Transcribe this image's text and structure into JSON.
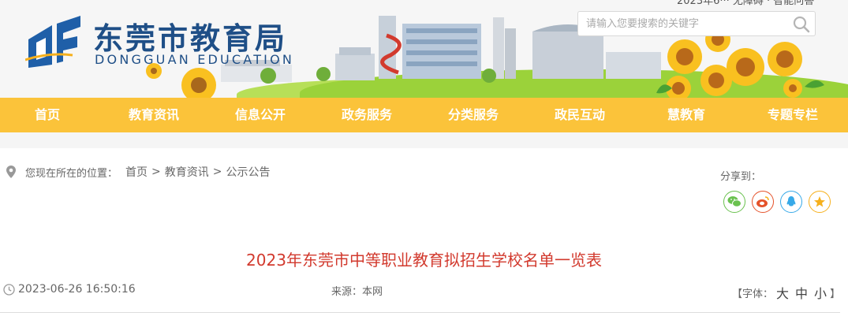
{
  "header": {
    "site_title": "东莞市教育局",
    "site_subtitle": "DONGGUAN EDUCATION",
    "top_info": "2023年6··· 无障碍 · 智能问答",
    "search": {
      "placeholder": "请输入您要搜索的关键字",
      "value": ""
    }
  },
  "nav": {
    "items": [
      {
        "label": "首页"
      },
      {
        "label": "教育资讯"
      },
      {
        "label": "信息公开"
      },
      {
        "label": "政务服务"
      },
      {
        "label": "分类服务"
      },
      {
        "label": "政民互动"
      },
      {
        "label": "慧教育"
      },
      {
        "label": "专题专栏"
      }
    ]
  },
  "breadcrumb": {
    "prefix": "您现在所在的位置：",
    "items": [
      "首页",
      "教育资讯",
      "公示公告"
    ],
    "separator": ">"
  },
  "share": {
    "label": "分享到：",
    "icons": [
      {
        "name": "wechat-icon",
        "color": "#6ac14f"
      },
      {
        "name": "weibo-icon",
        "color": "#e5532b"
      },
      {
        "name": "qq-icon",
        "color": "#37a9e8"
      },
      {
        "name": "qzone-icon",
        "color": "#f6b01c"
      }
    ]
  },
  "article": {
    "title": "2023年东莞市中等职业教育拟招生学校名单一览表",
    "datetime": "2023-06-26 16:50:16",
    "source_label": "来源：",
    "source": "本网",
    "font_label": "【字体：",
    "font_sizes": [
      "大",
      "中",
      "小"
    ],
    "font_close": "】"
  },
  "colors": {
    "nav_bg": "#fbc33a",
    "brand_blue": "#1f4f87",
    "title_red": "#d23a2e"
  }
}
